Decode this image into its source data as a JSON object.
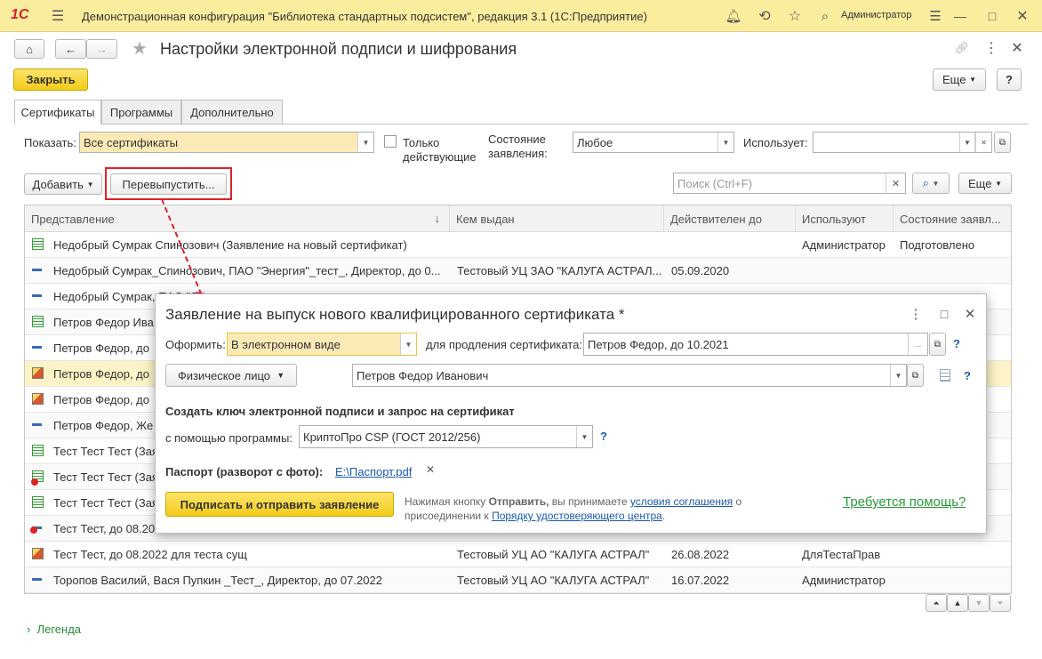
{
  "app": {
    "logo": "1С",
    "title": "Демонстрационная конфигурация \"Библиотека стандартных подсистем\", редакция 3.1  (1С:Предприятие)",
    "user": "Администратор"
  },
  "page": {
    "title": "Настройки электронной подписи и шифрования",
    "close_label": "Закрыть",
    "more_label": "Еще",
    "help_label": "?"
  },
  "tabs": [
    "Сертификаты",
    "Программы",
    "Дополнительно"
  ],
  "filters": {
    "show_label": "Показать:",
    "show_value": "Все сертификаты",
    "only_valid_label": "Только действующие",
    "state_label": "Состояние заявления:",
    "state_value": "Любое",
    "uses_label": "Использует:",
    "uses_value": ""
  },
  "toolbar": {
    "add_label": "Добавить",
    "reissue_label": "Перевыпустить...",
    "search_placeholder": "Поиск (Ctrl+F)",
    "more_label": "Еще"
  },
  "table": {
    "columns": [
      "Представление",
      "Кем выдан",
      "Действителен до",
      "Используют",
      "Состояние заявл..."
    ],
    "sort_arrow": "↓",
    "rows": [
      {
        "icon": "request",
        "name": "Недобрый Сумрак Спинозович (Заявление на новый сертификат)",
        "issuer": "",
        "valid": "",
        "user": "Администратор",
        "state": "Подготовлено"
      },
      {
        "icon": "cert",
        "name": "Недобрый Сумрак_Спинозович, ПАО \"Энергия\"_тест_, Директор, до 0...",
        "issuer": "Тестовый УЦ ЗАО \"КАЛУГА АСТРАЛ...",
        "valid": "05.09.2020",
        "user": "",
        "state": ""
      },
      {
        "icon": "cert",
        "name": "Недобрый Сумрак, ПАО \"Э",
        "issuer": "",
        "valid": "",
        "user": "",
        "state": ""
      },
      {
        "icon": "request",
        "name": "Петров Федор Ива",
        "issuer": "",
        "valid": "",
        "user": "",
        "state": ""
      },
      {
        "icon": "cert",
        "name": "Петров Федор, до",
        "issuer": "",
        "valid": "",
        "user": "",
        "state": ""
      },
      {
        "icon": "cert-person",
        "name": "Петров Федор, до",
        "issuer": "",
        "valid": "",
        "user": "",
        "state": ""
      },
      {
        "icon": "cert-person",
        "name": "Петров Федор, до",
        "issuer": "",
        "valid": "",
        "user": "",
        "state": ""
      },
      {
        "icon": "cert",
        "name": "Петров Федор, Же",
        "issuer": "",
        "valid": "",
        "user": "",
        "state": ""
      },
      {
        "icon": "request",
        "name": "Тест Тест Тест (Зая",
        "issuer": "",
        "valid": "",
        "user": "",
        "state": ""
      },
      {
        "icon": "request-error",
        "name": "Тест Тест Тест (Зая",
        "issuer": "",
        "valid": "",
        "user": "",
        "state": ""
      },
      {
        "icon": "request",
        "name": "Тест Тест Тест (Зая",
        "issuer": "",
        "valid": "",
        "user": "",
        "state": ""
      },
      {
        "icon": "cert-error",
        "name": "Тест Тест, до 08.20",
        "issuer": "",
        "valid": "",
        "user": "",
        "state": ""
      },
      {
        "icon": "cert-person",
        "name": "Тест Тест, до 08.2022 для теста сущ",
        "issuer": "Тестовый УЦ АО \"КАЛУГА АСТРАЛ\"",
        "valid": "26.08.2022",
        "user": "ДляТестаПрав",
        "state": ""
      },
      {
        "icon": "cert",
        "name": "Торопов Василий, Вася Пупкин _Тест_, Директор, до 07.2022",
        "issuer": "Тестовый УЦ АО \"КАЛУГА АСТРАЛ\"",
        "valid": "16.07.2022",
        "user": "Администратор",
        "state": ""
      }
    ]
  },
  "legend_label": "Легенда",
  "dialog": {
    "title": "Заявление на выпуск нового квалифицированного сертификата *",
    "format_label": "Оформить:",
    "format_value": "В электронном виде",
    "renew_label": "для продления сертификата:",
    "renew_value": "Петров Федор, до 10.2021",
    "person_type": "Физическое лицо",
    "person_value": "Петров Федор Иванович",
    "section_title": "Создать ключ электронной подписи и запрос на сертификат",
    "program_label": "с помощью программы:",
    "program_value": "КриптоПро CSP (ГОСТ 2012/256)",
    "passport_label": "Паспорт (разворот с фото):",
    "passport_link": "Е:\\Паспорт.pdf",
    "sign_button": "Подписать и отправить заявление",
    "note_1": "Нажимая кнопку ",
    "note_bold": "Отправить,",
    "note_2": " вы принимаете ",
    "note_link1": "условия соглашения",
    "note_3": " о присоединении к ",
    "note_link2": "Порядку удостоверяющего центра",
    "note_4": ".",
    "help_link": "Требуется помощь?",
    "q": "?"
  },
  "colors": {
    "titlebar": "#fbed9e",
    "accent_yellow": "#f5d430",
    "highlight_red": "#e0202a"
  }
}
